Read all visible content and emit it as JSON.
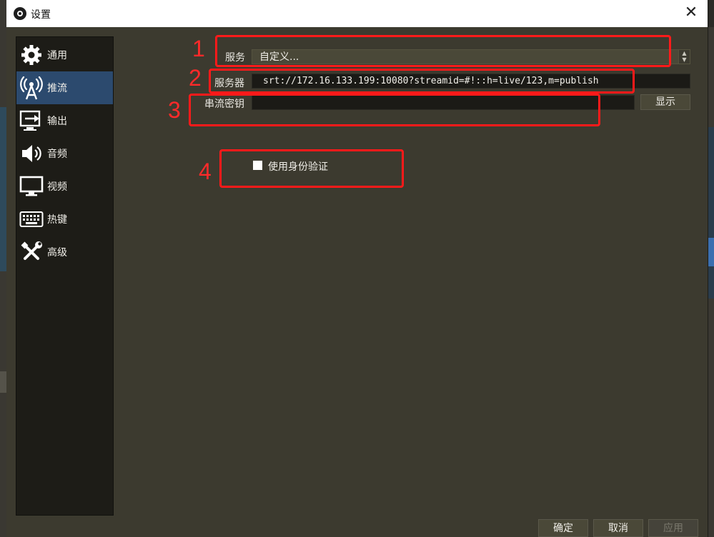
{
  "window": {
    "title": "设置"
  },
  "sidebar": {
    "items": [
      {
        "label": "通用",
        "icon": "gear-icon"
      },
      {
        "label": "推流",
        "icon": "antenna-icon"
      },
      {
        "label": "输出",
        "icon": "output-icon"
      },
      {
        "label": "音频",
        "icon": "speaker-icon"
      },
      {
        "label": "视频",
        "icon": "monitor-icon"
      },
      {
        "label": "热键",
        "icon": "keyboard-icon"
      },
      {
        "label": "高级",
        "icon": "tools-icon"
      }
    ],
    "active_index": 1
  },
  "stream": {
    "service_label": "服务",
    "service_value": "自定义...",
    "server_label": "服务器",
    "server_value": "srt://172.16.133.199:10080?streamid=#!::h=live/123,m=publish",
    "key_label": "串流密钥",
    "key_value": "",
    "show_button": "显示",
    "auth_checkbox_label": "使用身份验证",
    "auth_checked": false
  },
  "annotations": [
    "1",
    "2",
    "3",
    "4"
  ],
  "footer": {
    "ok": "确定",
    "cancel": "取消",
    "apply": "应用"
  },
  "colors": {
    "annotation": "#ff1a1a",
    "active_nav": "#2c4a6e",
    "window_bg": "#3c3a2f"
  }
}
